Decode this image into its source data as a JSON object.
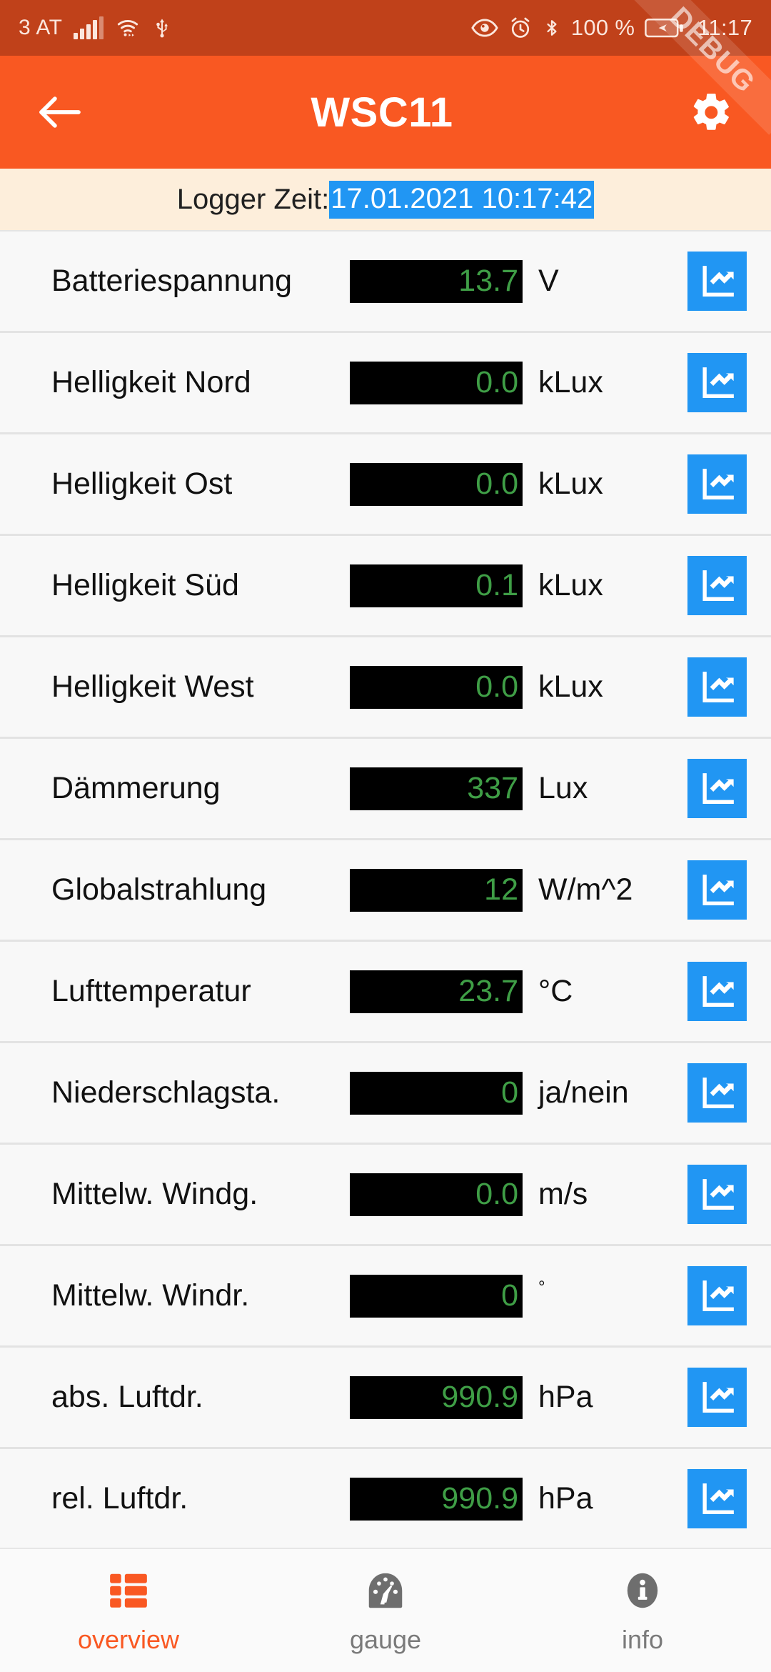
{
  "colors": {
    "status_bar_bg": "#c0411a",
    "app_bar_bg": "#f95822",
    "accent": "#f95822",
    "logger_bar_bg": "#fdeedb",
    "highlight_blue": "#2196f3",
    "value_green": "#3f9e46",
    "value_box_black": "#000000",
    "list_bg": "#f8f8f8",
    "inactive_gray": "#7a7a7a"
  },
  "status_bar": {
    "carrier": "3 AT",
    "battery_percent": "100 %",
    "time": "11:17",
    "icons": [
      "signal-bars-icon",
      "wifi-icon",
      "usb-icon",
      "eye-icon",
      "alarm-clock-icon",
      "bluetooth-icon",
      "battery-charging-icon"
    ]
  },
  "debug_ribbon": {
    "label": "DEBUG"
  },
  "app_bar": {
    "back_label": "back-arrow-icon",
    "title": "WSC11",
    "settings_label": "gear-icon"
  },
  "logger": {
    "label": "Logger Zeit:",
    "value": "17.01.2021 10:17:42"
  },
  "rows": [
    {
      "label": "Batteriespannung",
      "value": "13.7",
      "unit": "V",
      "unit_style": "normal"
    },
    {
      "label": "Helligkeit Nord",
      "value": "0.0",
      "unit": "kLux",
      "unit_style": "normal"
    },
    {
      "label": "Helligkeit Ost",
      "value": "0.0",
      "unit": "kLux",
      "unit_style": "normal"
    },
    {
      "label": "Helligkeit Süd",
      "value": "0.1",
      "unit": "kLux",
      "unit_style": "normal"
    },
    {
      "label": "Helligkeit West",
      "value": "0.0",
      "unit": "kLux",
      "unit_style": "normal"
    },
    {
      "label": "Dämmerung",
      "value": "337",
      "unit": "Lux",
      "unit_style": "normal"
    },
    {
      "label": "Globalstrahlung",
      "value": "12",
      "unit": "W/m^2",
      "unit_style": "normal"
    },
    {
      "label": "Lufttemperatur",
      "value": "23.7",
      "unit": "°C",
      "unit_style": "normal"
    },
    {
      "label": "Niederschlagsta.",
      "value": "0",
      "unit": "ja/nein",
      "unit_style": "normal"
    },
    {
      "label": "Mittelw. Windg.",
      "value": "0.0",
      "unit": "m/s",
      "unit_style": "normal"
    },
    {
      "label": "Mittelw. Windr.",
      "value": "0",
      "unit": "°",
      "unit_style": "degree"
    },
    {
      "label": "abs. Luftdr.",
      "value": "990.9",
      "unit": "hPa",
      "unit_style": "normal"
    },
    {
      "label": "rel. Luftdr.",
      "value": "990.9",
      "unit": "hPa",
      "unit_style": "normal"
    }
  ],
  "row_chart_icon": "line-chart-icon",
  "bottom_nav": {
    "items": [
      {
        "label": "overview",
        "icon": "dashboard-grid-icon",
        "active": true
      },
      {
        "label": "gauge",
        "icon": "speedometer-icon",
        "active": false
      },
      {
        "label": "info",
        "icon": "info-circle-icon",
        "active": false
      }
    ]
  }
}
